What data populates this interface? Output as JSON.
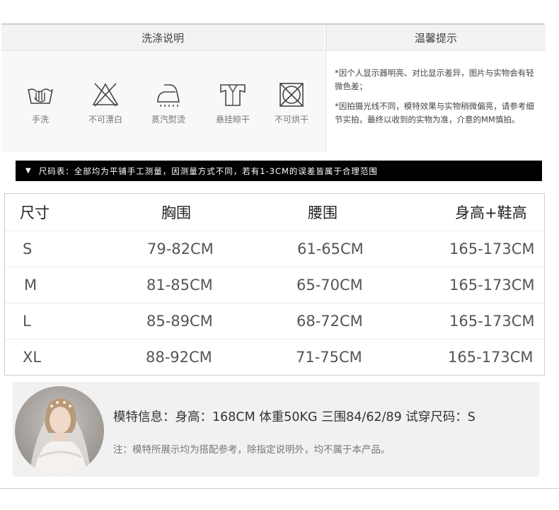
{
  "care": {
    "title": "洗涤说明",
    "items": [
      {
        "label": "手洗",
        "icon": "hand-wash-icon"
      },
      {
        "label": "不可漂白",
        "icon": "no-bleach-icon"
      },
      {
        "label": "蒸汽熨烫",
        "icon": "steam-iron-icon"
      },
      {
        "label": "悬挂晾干",
        "icon": "hang-dry-icon"
      },
      {
        "label": "不可烘干",
        "icon": "no-tumble-dry-icon"
      }
    ]
  },
  "tips": {
    "title": "温馨提示",
    "paragraphs": [
      "*因个人显示器明亮、对比显示差异，图片与实物会有轻微色差；",
      "*因拍摄光线不同，模特效果与实物稍微偏亮，请参考细节实拍，最终以收到的实物为准，介意的MM慎拍。"
    ]
  },
  "size_banner": {
    "marker": "▼",
    "text": "尺码表：全部均为平铺手工测量，因测量方式不同，若有1-3CM的误差皆属于合理范围"
  },
  "size_table": {
    "headers": [
      "尺寸",
      "胸围",
      "腰围",
      "身高+鞋高"
    ],
    "rows": [
      [
        "S",
        "79-82CM",
        "61-65CM",
        "165-173CM"
      ],
      [
        "M",
        "81-85CM",
        "65-70CM",
        "165-173CM"
      ],
      [
        "L",
        "85-89CM",
        "68-72CM",
        "165-173CM"
      ],
      [
        "XL",
        "88-92CM",
        "71-75CM",
        "165-173CM"
      ]
    ]
  },
  "model": {
    "info": "模特信息：身高：168CM  体重50KG  三围84/62/89  试穿尺码：S",
    "note": "注：模特所展示均为搭配参考，除指定说明外，均不属于本产品。"
  }
}
